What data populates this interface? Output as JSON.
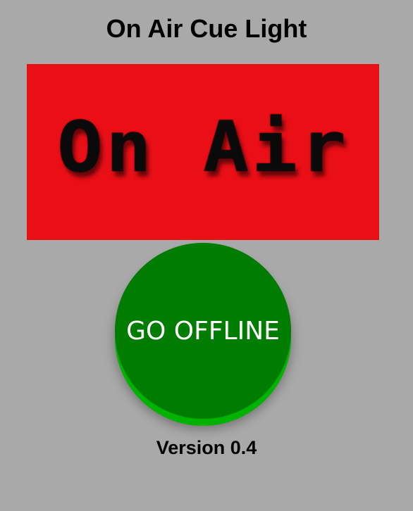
{
  "app": {
    "title": "On Air Cue Light",
    "version": "Version 0.4"
  },
  "sign": {
    "text": "On Air",
    "background_color": "#ea0e16",
    "text_color": "#0a0a0a"
  },
  "toggle_button": {
    "label": "GO OFFLINE",
    "color": "#007c00",
    "edge_color": "#00b300",
    "text_color": "#ffffff"
  },
  "page": {
    "background_color": "#a9a9a9"
  }
}
